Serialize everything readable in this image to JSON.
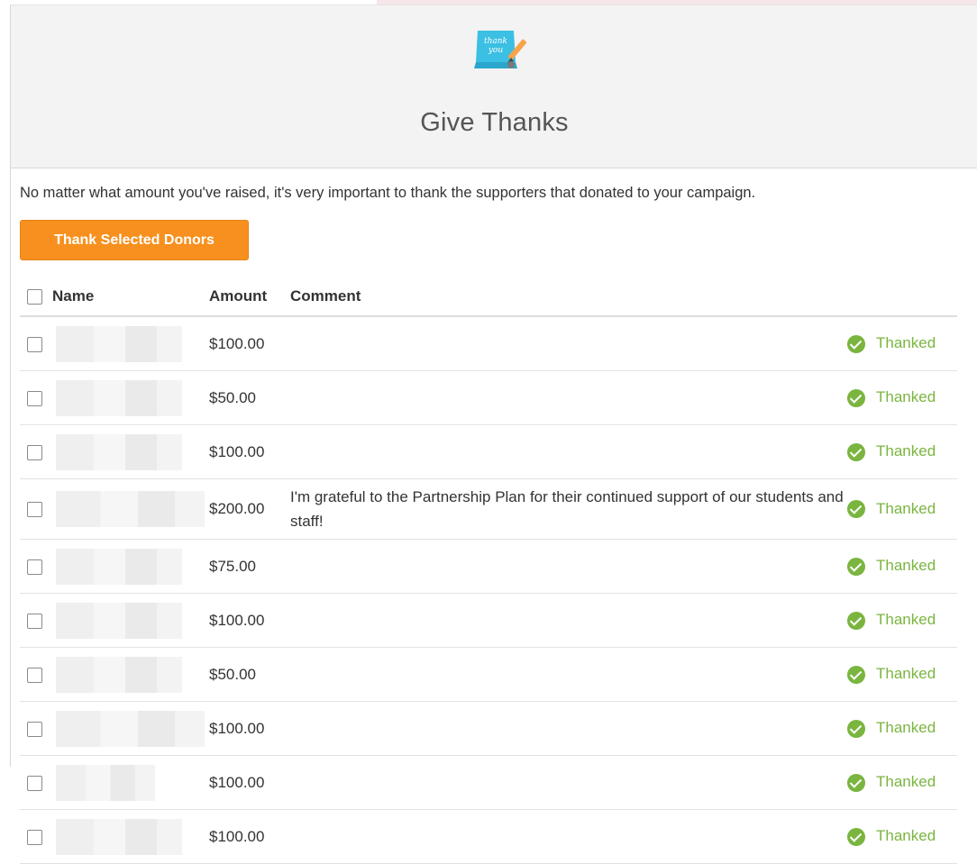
{
  "header": {
    "logo_text_line1": "thank",
    "logo_text_line2": "you",
    "title": "Give Thanks"
  },
  "intro_text": "No matter what amount you've raised, it's very important to thank the supporters that donated to your campaign.",
  "thank_button_label": "Thank Selected Donors",
  "table": {
    "columns": {
      "name": "Name",
      "amount": "Amount",
      "comment": "Comment"
    },
    "rows": [
      {
        "amount": "$100.00",
        "comment": "",
        "status": "Thanked"
      },
      {
        "amount": "$50.00",
        "comment": "",
        "status": "Thanked"
      },
      {
        "amount": "$100.00",
        "comment": "",
        "status": "Thanked"
      },
      {
        "amount": "$200.00",
        "comment": "I'm grateful to the Partnership Plan for their continued support of our students and staff!",
        "status": "Thanked"
      },
      {
        "amount": "$75.00",
        "comment": "",
        "status": "Thanked"
      },
      {
        "amount": "$100.00",
        "comment": "",
        "status": "Thanked"
      },
      {
        "amount": "$50.00",
        "comment": "",
        "status": "Thanked"
      },
      {
        "amount": "$100.00",
        "comment": "",
        "status": "Thanked"
      },
      {
        "amount": "$100.00",
        "comment": "",
        "status": "Thanked"
      },
      {
        "amount": "$100.00",
        "comment": "",
        "status": "Thanked"
      }
    ]
  },
  "colors": {
    "button": "#f7901e",
    "thanked": "#7ab53f",
    "header_bg": "#f3f3f3"
  },
  "icons": {
    "logo": "thank-you-card-icon",
    "status": "check-circle-icon"
  }
}
